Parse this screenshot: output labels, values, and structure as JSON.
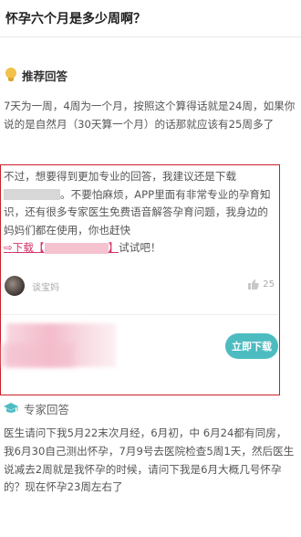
{
  "question": {
    "title": "怀孕六个月是多少周啊？"
  },
  "recommended": {
    "title": "推荐回答",
    "icon": "lightbulb-icon",
    "answer": "7天为一周，4周为一个月，按照这个算得话就是24周，如果你说的是自然月（30天算一个月）的话那就应该有25周多了"
  },
  "ad": {
    "text_part1": "不过，想要得到更加专业的回答，我建议还是下载",
    "text_part2": "。不要怕麻烦，APP里面有非常专业的孕育知识，还有很多专家医生免费语音解答孕育问题，我身边的妈妈们都在使用，你也赶快",
    "link_arrow": "⇨",
    "link_prefix": "下载【",
    "link_suffix": "】",
    "text_part3": "试试吧！",
    "user_name": "谈宝妈",
    "likes": "25",
    "button_label": "立即下载",
    "accent_color": "#4dbcc1",
    "border_color": "#c8202a"
  },
  "expert": {
    "title": "专家回答",
    "icon": "graduation-cap-icon",
    "answer": "医生请问下我5月22末次月经，6月初，中 6月24都有同房，我6月30自己测出怀孕，7月9号去医院检查5周1天，然后医生说减去2周就是我怀孕的时候，请问下我是6月大概几号怀孕的？现在怀孕23周左右了"
  }
}
